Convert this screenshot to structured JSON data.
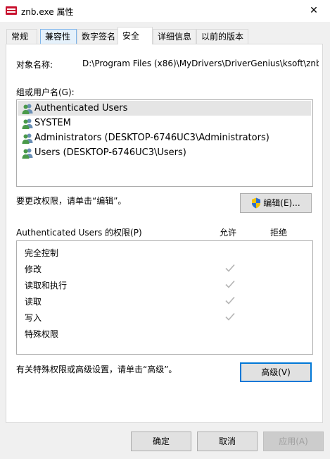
{
  "window": {
    "title": "znb.exe 属性",
    "close_glyph": "✕"
  },
  "tabs": [
    {
      "label": "常规"
    },
    {
      "label": "兼容性"
    },
    {
      "label": "数字签名"
    },
    {
      "label": "安全"
    },
    {
      "label": "详细信息"
    },
    {
      "label": "以前的版本"
    }
  ],
  "active_tab": "安全",
  "object_name": {
    "label": "对象名称:",
    "value": "D:\\Program Files (x86)\\MyDrivers\\DriverGenius\\ksoft\\znb"
  },
  "groups": {
    "label": "组或用户名(G):",
    "items": [
      {
        "name": "Authenticated Users",
        "selected": true
      },
      {
        "name": "SYSTEM"
      },
      {
        "name": "Administrators (DESKTOP-6746UC3\\Administrators)"
      },
      {
        "name": "Users (DESKTOP-6746UC3\\Users)"
      }
    ]
  },
  "edit": {
    "hint": "要更改权限，请单击“编辑”。",
    "button_label": "编辑(E)..."
  },
  "permissions": {
    "header": "Authenticated Users 的权限(P)",
    "allow_header": "允许",
    "deny_header": "拒绝",
    "rows": [
      {
        "name": "完全控制",
        "allow": false
      },
      {
        "name": "修改",
        "allow": true
      },
      {
        "name": "读取和执行",
        "allow": true
      },
      {
        "name": "读取",
        "allow": true
      },
      {
        "name": "写入",
        "allow": true
      },
      {
        "name": "特殊权限",
        "allow": false
      }
    ]
  },
  "advanced": {
    "hint": "有关特殊权限或高级设置，请单击“高级”。",
    "button_label": "高级(V)"
  },
  "footer": {
    "ok_label": "确定",
    "cancel_label": "取消",
    "apply_label": "应用(A)"
  },
  "colors": {
    "focus_border": "#0078d7",
    "check": "#b4b4b4",
    "selection": "#e5e5e5"
  }
}
